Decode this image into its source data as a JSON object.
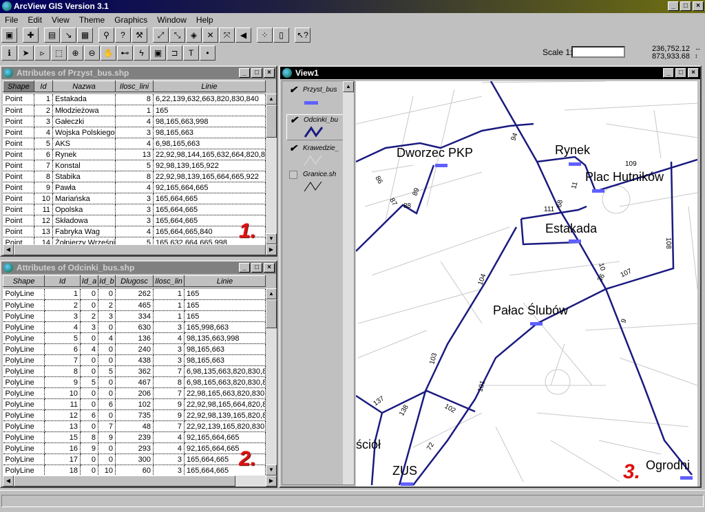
{
  "app": {
    "title": "ArcView GIS Version 3.1"
  },
  "menu": [
    "File",
    "Edit",
    "View",
    "Theme",
    "Graphics",
    "Window",
    "Help"
  ],
  "scale": {
    "label": "Scale 1:",
    "value": "",
    "x_coord": "236,752.12",
    "y_coord": "873,933.68"
  },
  "table1": {
    "title": "Attributes of Przyst_bus.shp",
    "columns": [
      "Shape",
      "Id",
      "Nazwa",
      "Ilosc_lini",
      "Linie"
    ],
    "rows": [
      [
        "Point",
        "1",
        "Estakada",
        "8",
        "6,22,139,632,663,820,830,840"
      ],
      [
        "Point",
        "2",
        "Młodzieżowa",
        "1",
        "165"
      ],
      [
        "Point",
        "3",
        "Gałeczki",
        "4",
        "98,165,663,998"
      ],
      [
        "Point",
        "4",
        "Wojska Polskiego",
        "3",
        "98,165,663"
      ],
      [
        "Point",
        "5",
        "AKS",
        "4",
        "6,98,165,663"
      ],
      [
        "Point",
        "6",
        "Rynek",
        "13",
        "22,92,98,144,165,632,664,820,83"
      ],
      [
        "Point",
        "7",
        "Konstal",
        "5",
        "92,98,139,165,922"
      ],
      [
        "Point",
        "8",
        "Stabika",
        "8",
        "22,92,98,139,165,664,665,922"
      ],
      [
        "Point",
        "9",
        "Pawła",
        "4",
        "92,165,664,665"
      ],
      [
        "Point",
        "10",
        "Mariańska",
        "3",
        "165,664,665"
      ],
      [
        "Point",
        "11",
        "Opolska",
        "3",
        "165,664,665"
      ],
      [
        "Point",
        "12",
        "Składowa",
        "3",
        "165,664,665"
      ],
      [
        "Point",
        "13",
        "Fabryka Wag",
        "4",
        "165,664,665,840"
      ],
      [
        "Point",
        "14",
        "Żołnierzy Wrześni",
        "5",
        "165,632,664,665,998"
      ]
    ],
    "annotation": "1."
  },
  "table2": {
    "title": "Attributes of Odcinki_bus.shp",
    "columns": [
      "Shape",
      "Id",
      "Id_a",
      "Id_b",
      "Dlugosc",
      "Ilosc_lin",
      "Linie"
    ],
    "rows": [
      [
        "PolyLine",
        "1",
        "0",
        "0",
        "262",
        "1",
        "165"
      ],
      [
        "PolyLine",
        "2",
        "0",
        "2",
        "465",
        "1",
        "165"
      ],
      [
        "PolyLine",
        "3",
        "2",
        "3",
        "334",
        "1",
        "165"
      ],
      [
        "PolyLine",
        "4",
        "3",
        "0",
        "630",
        "3",
        "165,998,663"
      ],
      [
        "PolyLine",
        "5",
        "0",
        "4",
        "136",
        "4",
        "98,135,663,998"
      ],
      [
        "PolyLine",
        "6",
        "4",
        "0",
        "240",
        "3",
        "98,165,663"
      ],
      [
        "PolyLine",
        "7",
        "0",
        "0",
        "438",
        "3",
        "98,165,663"
      ],
      [
        "PolyLine",
        "8",
        "0",
        "5",
        "362",
        "7",
        "6,98,135,663,820,830,8"
      ],
      [
        "PolyLine",
        "9",
        "5",
        "0",
        "467",
        "8",
        "6,98,165,663,820,830,8"
      ],
      [
        "PolyLine",
        "10",
        "0",
        "0",
        "206",
        "7",
        "22,98,165,663,820,830"
      ],
      [
        "PolyLine",
        "11",
        "0",
        "6",
        "102",
        "9",
        "22,92,98,165,664,820,8"
      ],
      [
        "PolyLine",
        "12",
        "6",
        "0",
        "735",
        "9",
        "22,92,98,139,165,820,8"
      ],
      [
        "PolyLine",
        "13",
        "0",
        "7",
        "48",
        "7",
        "22,92,139,165,820,830"
      ],
      [
        "PolyLine",
        "15",
        "8",
        "9",
        "239",
        "4",
        "92,165,664,665"
      ],
      [
        "PolyLine",
        "16",
        "9",
        "0",
        "293",
        "4",
        "92,165,664,665"
      ],
      [
        "PolyLine",
        "17",
        "0",
        "0",
        "300",
        "3",
        "165,664,665"
      ],
      [
        "PolyLine",
        "18",
        "0",
        "10",
        "60",
        "3",
        "165,664,665"
      ]
    ],
    "annotation": "2."
  },
  "view": {
    "title": "View1",
    "annotation": "3.",
    "legend": [
      {
        "name": "Przyst_bus",
        "checked": true
      },
      {
        "name": "Odcinki_bu",
        "checked": true
      },
      {
        "name": "Krawedzie_",
        "checked": true
      },
      {
        "name": "Granice.sh",
        "checked": false
      }
    ],
    "place_labels": [
      "Dworzec PKP",
      "Rynek",
      "Plac Hutników",
      "Estakada",
      "Pałac Ślubów",
      "ściół",
      "ZUS",
      "Ogrodni"
    ],
    "segment_labels": [
      "94",
      "86",
      "87",
      "88",
      "89",
      "111",
      "68",
      "11",
      "109",
      "108",
      "10",
      "36",
      "107",
      "104",
      "103",
      "102",
      "101",
      "137",
      "138",
      "72",
      "9"
    ],
    "colors": {
      "route": "#1a1a80",
      "stop": "#6060ff"
    }
  }
}
